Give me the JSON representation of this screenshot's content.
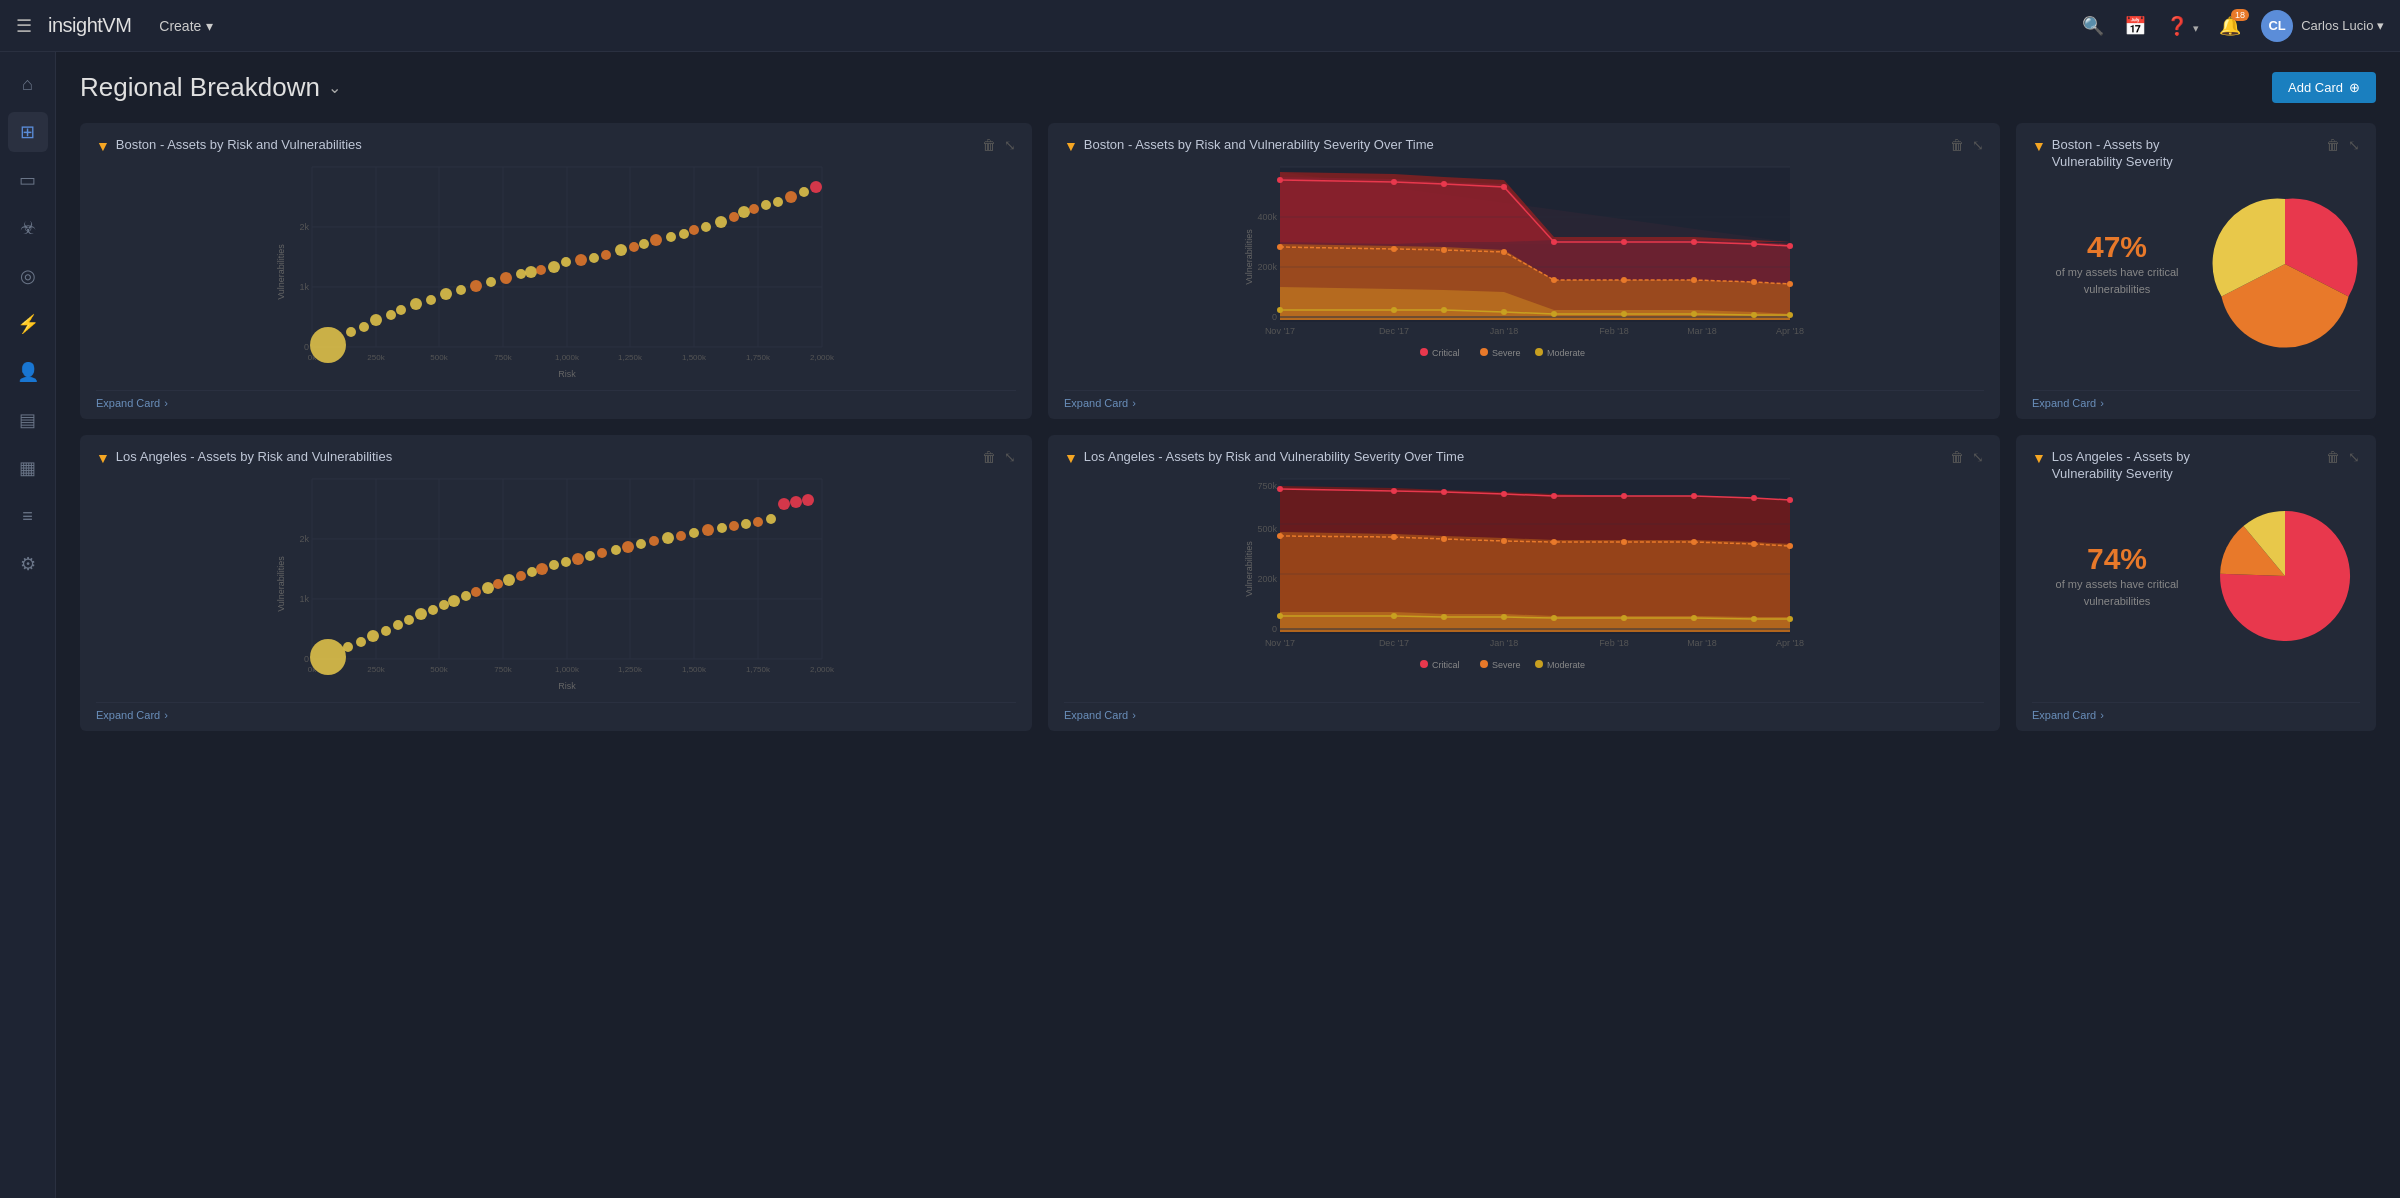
{
  "app": {
    "logo": "insightVM",
    "nav_create": "Create",
    "nav_chevron": "▾"
  },
  "header": {
    "page_title": "Regional Breakdown",
    "add_card_label": "Add Card",
    "chevron": "⌄"
  },
  "sidebar": {
    "items": [
      {
        "id": "home",
        "icon": "⌂"
      },
      {
        "id": "dashboard",
        "icon": "⊞"
      },
      {
        "id": "monitor",
        "icon": "▭"
      },
      {
        "id": "virus",
        "icon": "⚠"
      },
      {
        "id": "target",
        "icon": "◎"
      },
      {
        "id": "lightning",
        "icon": "⚡"
      },
      {
        "id": "user",
        "icon": "👤"
      },
      {
        "id": "table",
        "icon": "▤"
      },
      {
        "id": "chart",
        "icon": "▦"
      },
      {
        "id": "list",
        "icon": "≡"
      },
      {
        "id": "settings",
        "icon": "⚙"
      }
    ]
  },
  "cards": {
    "boston_scatter": {
      "title": "Boston - Assets by Risk and Vulnerabilities",
      "expand_label": "Expand Card",
      "x_axis": "Risk",
      "y_axis": "Vulnerabilities",
      "y_ticks": [
        "0",
        "1k",
        "2k"
      ],
      "x_ticks": [
        "0k",
        "250k",
        "500k",
        "750k",
        "1,000k",
        "1,250k",
        "1,500k",
        "1,750k",
        "2,000k"
      ]
    },
    "boston_line": {
      "title": "Boston - Assets by Risk and Vulnerability Severity Over Time",
      "expand_label": "Expand Card",
      "y_ticks": [
        "0",
        "200k",
        "400k"
      ],
      "x_ticks": [
        "Nov '17",
        "Dec '17",
        "Jan '18",
        "Feb '18",
        "Mar '18",
        "Apr '18"
      ],
      "y_axis": "Vulnerabilities",
      "legend": [
        {
          "label": "Critical",
          "color": "#e8384d"
        },
        {
          "label": "Severe",
          "color": "#e8792a"
        },
        {
          "label": "Moderate",
          "color": "#c0922a"
        }
      ]
    },
    "boston_pie": {
      "title": "Boston - Assets by\nVulnerability Severity",
      "title_line1": "Boston - Assets by",
      "title_line2": "Vulnerability Severity",
      "expand_label": "Expand Card",
      "percentage": "47%",
      "description": "of my assets have critical\nvulnerabilities",
      "desc_line1": "of my assets have critical",
      "desc_line2": "vulnerabilities",
      "pie_slices": [
        {
          "color": "#e8384d",
          "value": 47
        },
        {
          "color": "#e8792a",
          "value": 30
        },
        {
          "color": "#f5c842",
          "value": 23
        }
      ]
    },
    "la_scatter": {
      "title": "Los Angeles - Assets by Risk and Vulnerabilities",
      "expand_label": "Expand Card",
      "x_axis": "Risk",
      "y_axis": "Vulnerabilities",
      "y_ticks": [
        "0",
        "1k",
        "2k"
      ],
      "x_ticks": [
        "0k",
        "250k",
        "500k",
        "750k",
        "1,000k",
        "1,250k",
        "1,500k",
        "1,750k",
        "2,000k"
      ]
    },
    "la_line": {
      "title": "Los Angeles - Assets by Risk and Vulnerability Severity Over Time",
      "expand_label": "Expand Card",
      "y_ticks": [
        "0",
        "200k",
        "500k",
        "750k"
      ],
      "x_ticks": [
        "Nov '17",
        "Dec '17",
        "Jan '18",
        "Feb '18",
        "Mar '18",
        "Apr '18"
      ],
      "y_axis": "Vulnerabilities",
      "legend": [
        {
          "label": "Critical",
          "color": "#e8384d"
        },
        {
          "label": "Severe",
          "color": "#e8792a"
        },
        {
          "label": "Moderate",
          "color": "#c0922a"
        }
      ]
    },
    "la_pie": {
      "title_line1": "Los Angeles - Assets by",
      "title_line2": "Vulnerability Severity",
      "expand_label": "Expand Card",
      "percentage": "74%",
      "desc_line1": "of my assets have critical",
      "desc_line2": "vulnerabilities",
      "pie_slices": [
        {
          "color": "#e8384d",
          "value": 74
        },
        {
          "color": "#e8792a",
          "value": 15
        },
        {
          "color": "#f5c842",
          "value": 11
        }
      ]
    }
  },
  "icons": {
    "filter": "▼",
    "delete": "🗑",
    "expand_icon": "⤡",
    "plus": "⊕",
    "chevron_right": "›"
  }
}
